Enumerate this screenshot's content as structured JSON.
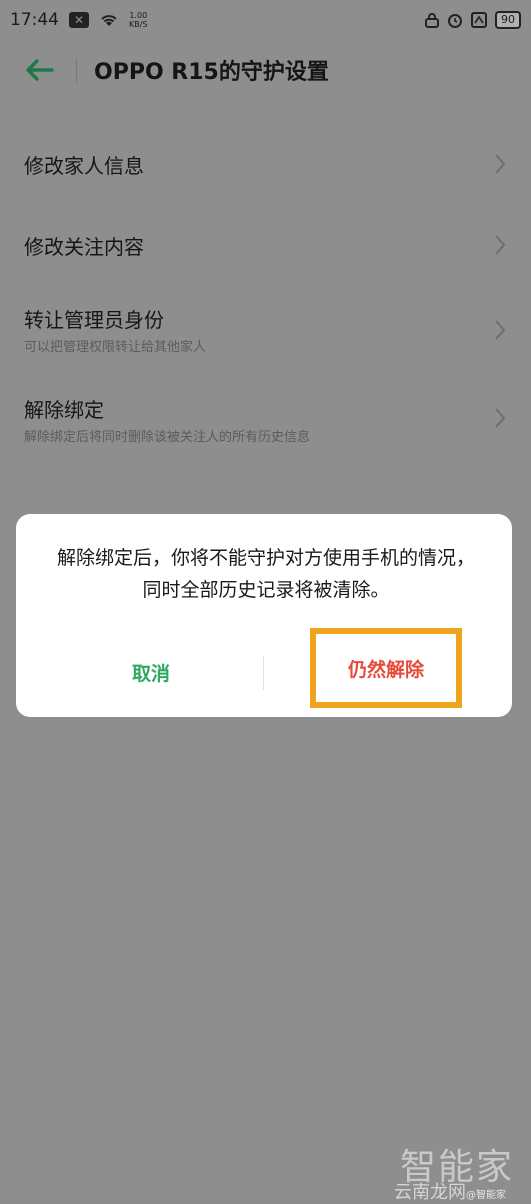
{
  "status_bar": {
    "time": "17:44",
    "net_speed_value": "1.00",
    "net_speed_unit": "KB/S",
    "battery": "90"
  },
  "header": {
    "title": "OPPO R15的守护设置"
  },
  "menu": [
    {
      "title": "修改家人信息",
      "subtitle": ""
    },
    {
      "title": "修改关注内容",
      "subtitle": ""
    },
    {
      "title": "转让管理员身份",
      "subtitle": "可以把管理权限转让给其他家人"
    },
    {
      "title": "解除绑定",
      "subtitle": "解除绑定后将同时删除该被关注人的所有历史信息"
    }
  ],
  "dialog": {
    "message": "解除绑定后，你将不能守护对方使用手机的情况，同时全部历史记录将被清除。",
    "cancel_label": "取消",
    "confirm_label": "仍然解除"
  },
  "watermark": {
    "logo": "智能家",
    "site": "云南龙网",
    "handle": "@智能家"
  },
  "colors": {
    "accent_green": "#2fa862",
    "danger_red": "#e84b3c",
    "highlight_orange": "#f0a41e"
  }
}
